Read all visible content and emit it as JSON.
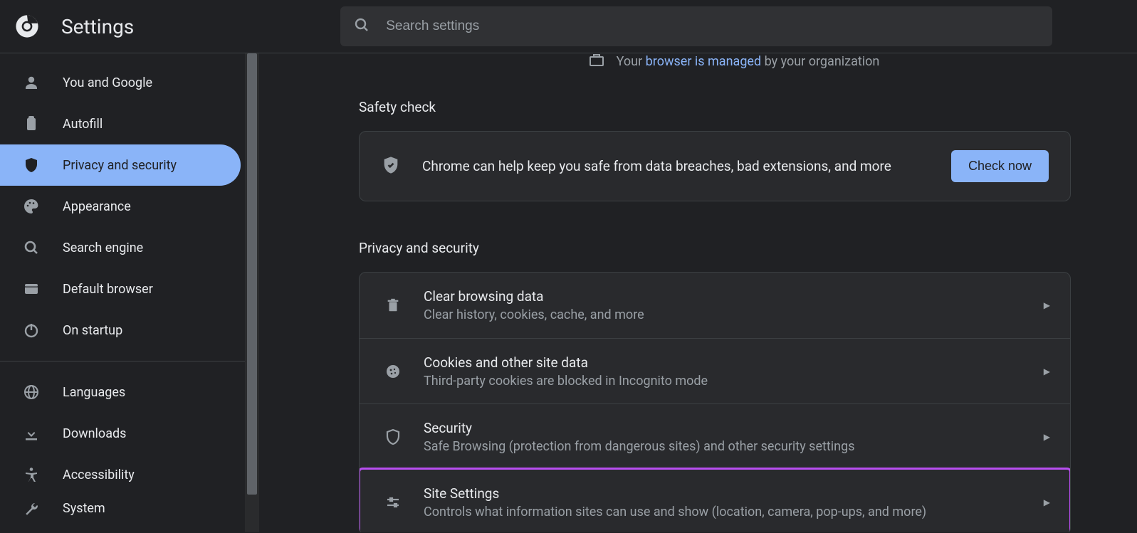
{
  "header": {
    "title": "Settings",
    "search_placeholder": "Search settings"
  },
  "managed": {
    "prefix": "Your ",
    "link": "browser is managed",
    "suffix": " by your organization"
  },
  "sidebar": {
    "items": [
      {
        "label": "You and Google"
      },
      {
        "label": "Autofill"
      },
      {
        "label": "Privacy and security"
      },
      {
        "label": "Appearance"
      },
      {
        "label": "Search engine"
      },
      {
        "label": "Default browser"
      },
      {
        "label": "On startup"
      }
    ],
    "items2": [
      {
        "label": "Languages"
      },
      {
        "label": "Downloads"
      },
      {
        "label": "Accessibility"
      },
      {
        "label": "System"
      }
    ]
  },
  "safety": {
    "heading": "Safety check",
    "text": "Chrome can help keep you safe from data breaches, bad extensions, and more",
    "button": "Check now"
  },
  "privacy": {
    "heading": "Privacy and security",
    "rows": [
      {
        "title": "Clear browsing data",
        "sub": "Clear history, cookies, cache, and more"
      },
      {
        "title": "Cookies and other site data",
        "sub": "Third-party cookies are blocked in Incognito mode"
      },
      {
        "title": "Security",
        "sub": "Safe Browsing (protection from dangerous sites) and other security settings"
      },
      {
        "title": "Site Settings",
        "sub": "Controls what information sites can use and show (location, camera, pop-ups, and more)"
      }
    ]
  }
}
